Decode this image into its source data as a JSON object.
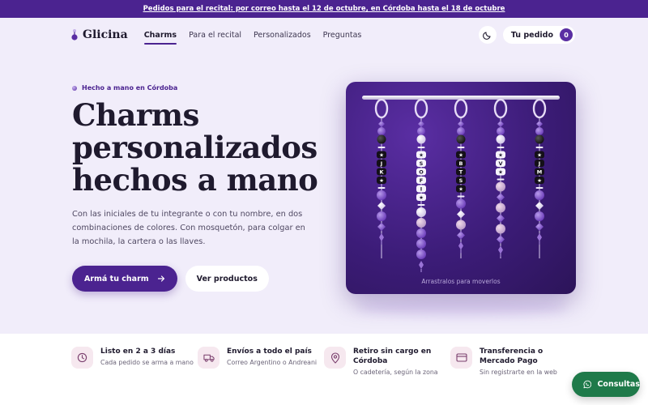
{
  "announcement": "Pedidos para el recital: por correo hasta el 12 de octubre, en Córdoba hasta el 18 de octubre",
  "brand": {
    "name": "Glicina"
  },
  "nav": {
    "items": [
      {
        "label": "Charms",
        "active": true
      },
      {
        "label": "Para el recital",
        "active": false
      },
      {
        "label": "Personalizados",
        "active": false
      },
      {
        "label": "Preguntas",
        "active": false
      }
    ],
    "cart_label": "Tu pedido",
    "cart_count": "0"
  },
  "hero": {
    "eyebrow": "Hecho a mano en Córdoba",
    "title": "Charms personalizados hechos a mano",
    "description": "Con las iniciales de tu integrante o con tu nombre, en dos combinaciones de colores. Con mosquetón, para colgar en la mochila, la cartera o las llaves.",
    "primary_cta": "Armá tu charm",
    "secondary_cta": "Ver productos"
  },
  "visual": {
    "caption": "Arrastralos para moverlos",
    "strands": [
      [
        "★",
        "J",
        "K",
        "★"
      ],
      [
        "★",
        "S",
        "O",
        "F",
        "I",
        "★"
      ],
      [
        "★",
        "B",
        "T",
        "S",
        "★"
      ],
      [
        "★",
        "V",
        "★"
      ],
      [
        "★",
        "J",
        "M",
        "★"
      ]
    ]
  },
  "features": [
    {
      "icon": "clock-icon",
      "title": "Listo en 2 a 3 días",
      "subtitle": "Cada pedido se arma a mano"
    },
    {
      "icon": "truck-icon",
      "title": "Envíos a todo el país",
      "subtitle": "Correo Argentino o Andreani"
    },
    {
      "icon": "location-pin-icon",
      "title": "Retiro sin cargo en Córdoba",
      "subtitle": "O cadetería, según la zona"
    },
    {
      "icon": "credit-card-icon",
      "title": "Transferencia o Mercado Pago",
      "subtitle": "Sin registrarte en la web"
    }
  ],
  "chat": {
    "label": "Consultas"
  },
  "colors": {
    "primary": "#4b2390",
    "background": "#f1edfa",
    "whatsapp": "#1f7a4a",
    "feature_icon_bg": "#f6e8ef"
  }
}
